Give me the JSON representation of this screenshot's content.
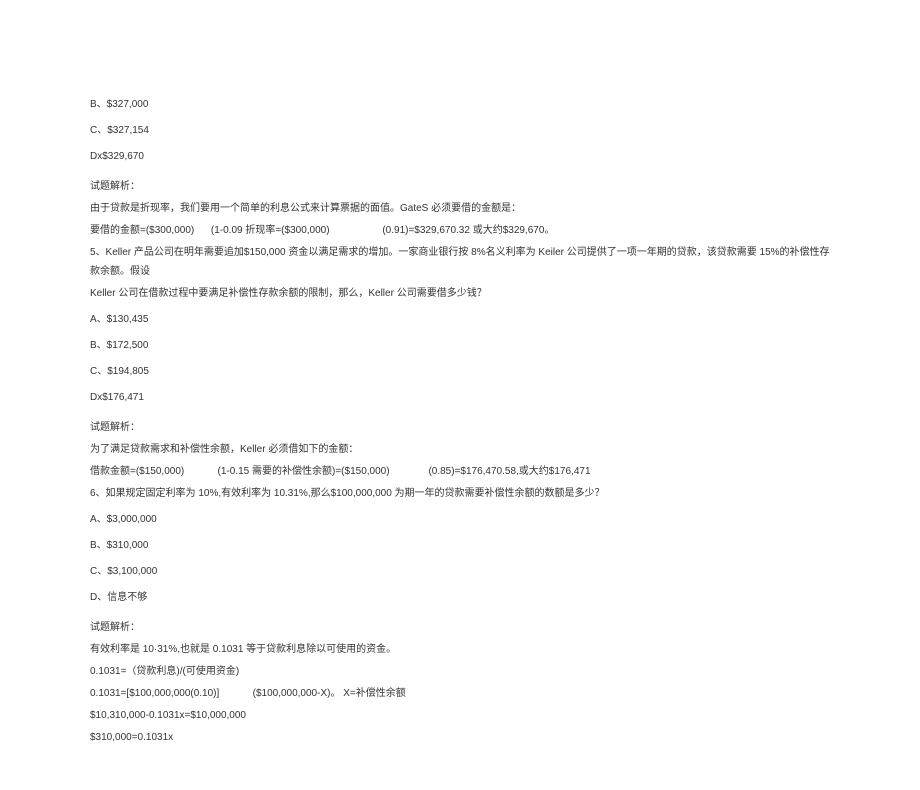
{
  "lines": {
    "opt_b_1": "B、$327,000",
    "opt_c_1": "C、$327,154",
    "opt_d_1": "Dx$329,670",
    "analysis_label_1": "试题解析：",
    "analysis_1a": "由于贷款是折现率，我们要用一个简单的利息公式来计算票据的面值。GateS 必须要借的金额是：",
    "analysis_1b": "要借的金额=($300,000)      (1-0.09 折现率=($300,000)                   (0.91)=$329,670.32 或大约$329,670。",
    "q5": "5、Keller 产品公司在明年需要追加$150,000 资金以满足需求的增加。一家商业银行按 8%名义利率为 Keiler 公司提供了一项一年期的贷款，该贷款需要 15%的补偿性存款余额。假设",
    "q5b": "Keller 公司在借款过程中要满足补偿性存款余额的限制，那么，Keller 公司需要借多少钱？",
    "opt_a_2": "A、$130,435",
    "opt_b_2": "B、$172,500",
    "opt_c_2": "C、$194,805",
    "opt_d_2": "Dx$176,471",
    "analysis_label_2": "试题解析：",
    "analysis_2a": "为了满足贷款需求和补偿性余额，Keller 必须借如下的金额：",
    "analysis_2b": "借款金额=($150,000)            (1-0.15 需要的补偿性余额)=($150,000)              (0.85)=$176,470.58,或大约$176,471",
    "q6": "6、如果规定固定利率为 10%,有效利率为 10.31%,那么$100,000,000 为期一年的贷款需要补偿性余额的数额是多少？",
    "opt_a_3": "A、$3,000,000",
    "opt_b_3": "B、$310,000",
    "opt_c_3": "C、$3,100,000",
    "opt_d_3": "D、信息不够",
    "analysis_label_3": "试题解析：",
    "analysis_3a": "有效利率是 10·31%,也就是 0.1031 等于贷款利息除以可使用的资金。",
    "analysis_3b": "0.1031=（贷款利息)/(可使用资金)",
    "analysis_3c": "0.1031=[$100,000,000(0.10)]            ($100,000,000-X)。 X=补偿性余额",
    "analysis_3d": "$10,310,000-0.1031x=$10,000,000",
    "analysis_3e": "$310,000=0.1031x"
  }
}
